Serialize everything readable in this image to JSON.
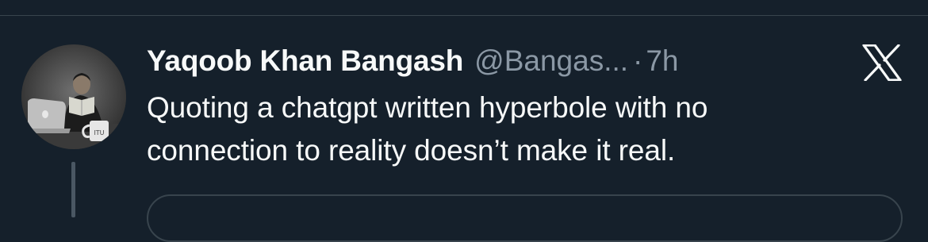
{
  "tweet": {
    "author_name": "Yaqoob Khan Bangash",
    "handle": "@Bangas...",
    "separator": "·",
    "time": "7h",
    "text_line1": "Quoting a chatgpt written hyperbole with no",
    "text_line2": "connection to reality doesn’t make it real."
  },
  "icons": {
    "platform_logo": "x-logo-icon",
    "avatar": "profile-photo"
  },
  "colors": {
    "background": "#15202b",
    "primary_text": "#f7f9f9",
    "secondary_text": "#8b98a5",
    "border": "#38444d"
  }
}
